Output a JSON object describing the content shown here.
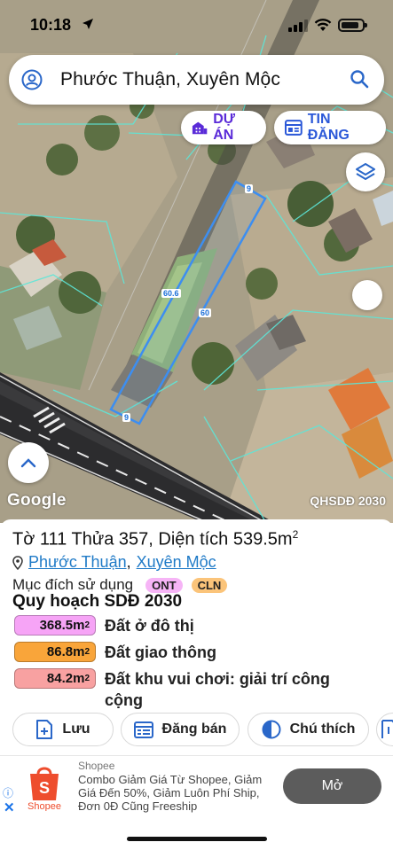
{
  "status_bar": {
    "time": "10:18"
  },
  "search": {
    "title": "Phước Thuận, Xuyên Mộc"
  },
  "chips": {
    "du_an": "DỰ ÁN",
    "tin_dang": "TIN ĐĂNG"
  },
  "map": {
    "google_label": "Google",
    "layer_label": "QHSDĐ 2030",
    "dimensions": {
      "top": "9",
      "left": "60.6",
      "right": "60",
      "bottom": "9"
    }
  },
  "parcel": {
    "title_prefix": "Tờ 111 Thửa 357, Diện tích 539.5m",
    "title_sup": "2",
    "location_ward": "Phước Thuận",
    "location_sep": ",",
    "location_district": "Xuyên Mộc",
    "purpose_label": "Mục đích sử dụng",
    "purpose_tags": [
      "ONT",
      "CLN"
    ],
    "plan_title": "Quy hoạch SDĐ 2030",
    "zones": [
      {
        "area": "368.5m",
        "label": "Đất ở đô thị",
        "color": "#f6a4f6"
      },
      {
        "area": "86.8m",
        "label": "Đất giao thông",
        "color": "#f9a53a"
      },
      {
        "area": "84.2m",
        "label": "Đất khu vui chơi: giải trí công cộng",
        "color": "#f8a1a1"
      }
    ]
  },
  "actions": {
    "save": "Lưu",
    "post": "Đăng bán",
    "legend": "Chú thích"
  },
  "ad": {
    "brand": "Shopee",
    "logo_text": "Shopee",
    "text": "Combo Giảm Giá Từ Shopee, Giảm Giá Đến 50%, Giảm Luôn Phí Ship, Đơn 0Đ Cũng Freeship",
    "button": "Mở"
  }
}
